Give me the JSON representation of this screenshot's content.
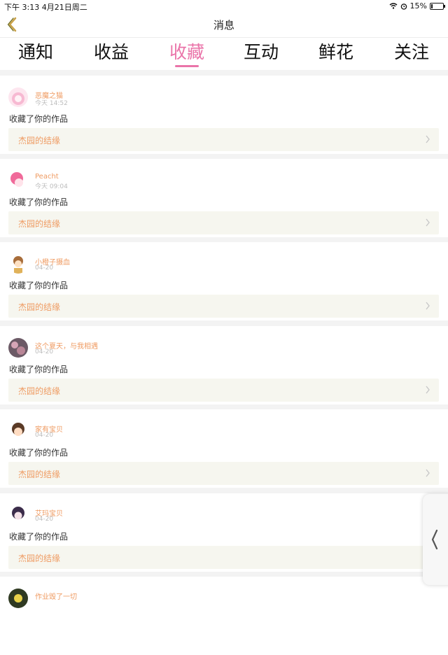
{
  "status": {
    "time_date": "下午 3:13   4月21日周二",
    "battery": "15%",
    "battery_level": 0.15
  },
  "nav": {
    "title": "消息",
    "back_icon": "chevron-left-icon"
  },
  "tabs": [
    {
      "label": "通知",
      "active": false
    },
    {
      "label": "收益",
      "active": false
    },
    {
      "label": "收藏",
      "active": true
    },
    {
      "label": "互动",
      "active": false
    },
    {
      "label": "鲜花",
      "active": false
    },
    {
      "label": "关注",
      "active": false
    }
  ],
  "colors": {
    "accent": "#ea74a9",
    "name": "#ef9b62",
    "work_bg": "#f6f6ef"
  },
  "items": [
    {
      "user": "恶魔之猫",
      "time": "今天 14:52",
      "action": "收藏了你的作品",
      "work": "杰园的结缘"
    },
    {
      "user": "Peacht",
      "time": "今天 09:04",
      "action": "收藏了你的作品",
      "work": "杰园的结缘"
    },
    {
      "user": "小橙子摄血",
      "time": "04-20",
      "action": "收藏了你的作品",
      "work": "杰园的结缘"
    },
    {
      "user": "这个夏天，与我相遇",
      "time": "04-20",
      "action": "收藏了你的作品",
      "work": "杰园的结缘"
    },
    {
      "user": "家有宝贝",
      "time": "04-20",
      "action": "收藏了你的作品",
      "work": "杰园的结缘"
    },
    {
      "user": "艾玛宝贝",
      "time": "04-20",
      "action": "收藏了你的作品",
      "work": "杰园的结缘"
    },
    {
      "user": "作业毁了一切",
      "time": "",
      "action": "",
      "work": ""
    }
  ]
}
